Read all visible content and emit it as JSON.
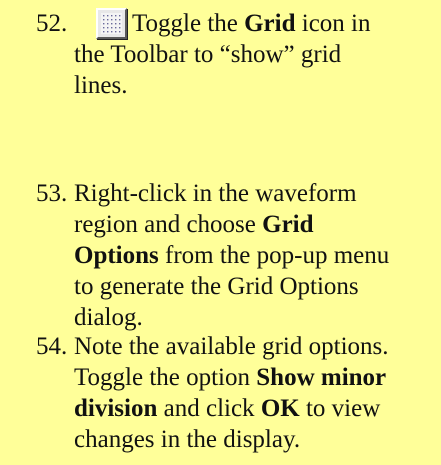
{
  "steps": [
    {
      "number": "52.",
      "lines": [
        [
          {
            "text": "Toggle the ",
            "bold": false
          },
          {
            "text": "Grid",
            "bold": true
          },
          {
            "text": " icon in",
            "bold": false
          }
        ],
        [
          {
            "text": "the Toolbar to “show” grid",
            "bold": false
          }
        ],
        [
          {
            "text": "lines.",
            "bold": false
          }
        ]
      ],
      "icon": "grid-icon"
    },
    {
      "number": "53.",
      "lines": [
        [
          {
            "text": "Right-click in the waveform",
            "bold": false
          }
        ],
        [
          {
            "text": "region and choose ",
            "bold": false
          },
          {
            "text": "Grid",
            "bold": true
          }
        ],
        [
          {
            "text": "Options",
            "bold": true
          },
          {
            "text": " from the pop-up menu",
            "bold": false
          }
        ],
        [
          {
            "text": "to generate the Grid Options",
            "bold": false
          }
        ],
        [
          {
            "text": "dialog.",
            "bold": false
          }
        ]
      ]
    },
    {
      "number": "54.",
      "lines": [
        [
          {
            "text": "Note the available grid options.",
            "bold": false
          }
        ],
        [
          {
            "text": "Toggle the option ",
            "bold": false
          },
          {
            "text": "Show minor",
            "bold": true
          }
        ],
        [
          {
            "text": "division",
            "bold": true
          },
          {
            "text": " and click ",
            "bold": false
          },
          {
            "text": "OK",
            "bold": true
          },
          {
            "text": " to view",
            "bold": false
          }
        ],
        [
          {
            "text": "changes in the display.",
            "bold": false
          }
        ]
      ]
    }
  ],
  "colors": {
    "background": "#ffff99",
    "text": "#111111"
  }
}
